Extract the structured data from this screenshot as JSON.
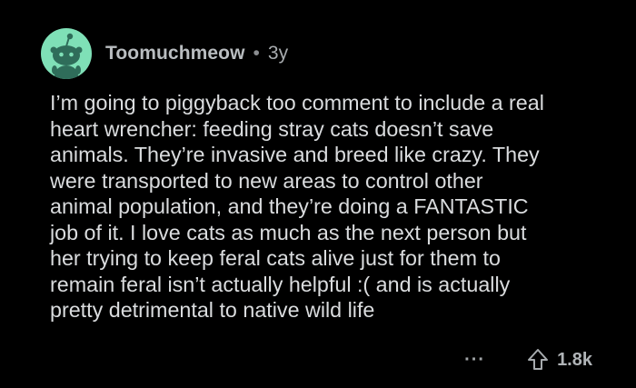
{
  "comment": {
    "author": "Toomuchmeow",
    "separator": "•",
    "age": "3y",
    "body_lines": [
      "I’m going to piggyback too comment to include a real",
      "heart wrencher: feeding stray cats doesn’t save",
      "animals. They’re invasive and breed like crazy. They",
      "were transported to new areas to control other",
      "animal population, and they’re doing a FANTASTIC",
      "job of it. I love cats as much as the next person but",
      "her trying to keep feral cats alive just for them to",
      "remain feral isn’t actually helpful :( and is actually",
      "pretty detrimental to native wild life"
    ],
    "more_label": "···",
    "upvote_count": "1.8k"
  },
  "icons": {
    "avatar": "snoo-avatar-icon",
    "more": "more-options-icon",
    "upvote": "upvote-arrow-icon"
  },
  "colors": {
    "background": "#000000",
    "avatar_bg": "#7fe0b7",
    "text": "#dadcde",
    "meta_text": "#b9bdc0"
  }
}
